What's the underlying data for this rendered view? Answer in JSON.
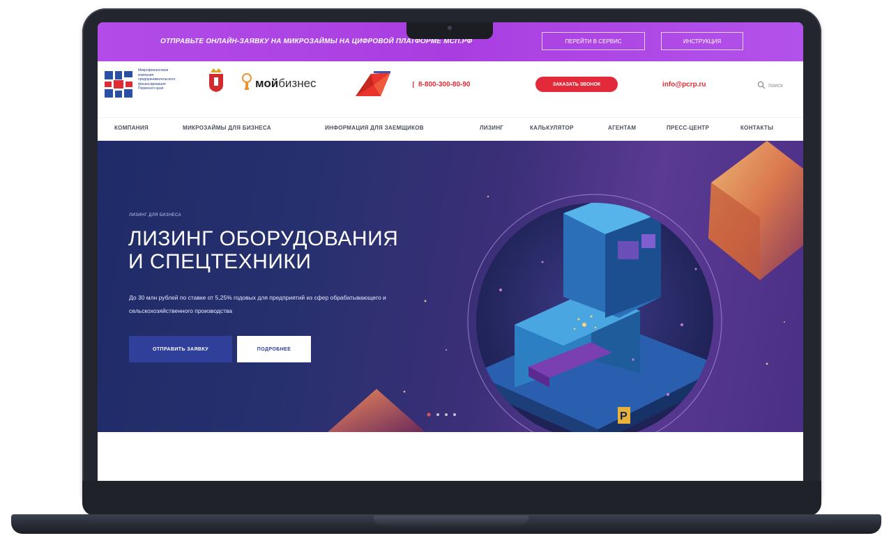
{
  "promo": {
    "text": "ОТПРАВЬТЕ ОНЛАЙН-ЗАЯВКУ НА МИКРОЗАЙМЫ НА ЦИФРОВОЙ ПЛАТФОРМЕ МСП.РФ",
    "go_service": "ПЕРЕЙТИ В СЕРВИС",
    "instruction": "ИНСТРУКЦИЯ"
  },
  "header": {
    "fund_name": "Микрофинансовая компания предпринимательского финансирования Пермского края",
    "moy_prefix": "мой",
    "moy_suffix": "бизнес",
    "phone": "8-800-300-80-90",
    "phone_icon": "phone-icon",
    "callback": "ЗАКАЗАТЬ ЗВОНОК",
    "email": "info@pcrp.ru",
    "search_label": "поиск",
    "search_icon": "search-icon"
  },
  "nav": {
    "items": [
      "КОМПАНИЯ",
      "МИКРОЗАЙМЫ ДЛЯ БИЗНЕСА",
      "ИНФОРМАЦИЯ ДЛЯ ЗАЕМЩИКОВ",
      "ЛИЗИНГ",
      "КАЛЬКУЛЯТОР",
      "АГЕНТАМ",
      "ПРЕСС-ЦЕНТР",
      "КОНТАКТЫ"
    ]
  },
  "hero": {
    "eyebrow": "ЛИЗИНГ ДЛЯ БИЗНЕСА",
    "title_line1": "ЛИЗИНГ ОБОРУДОВАНИЯ",
    "title_line2": "И СПЕЦТЕХНИКИ",
    "description": "До 30 млн рублей по ставке от 5,25% годовых для предприятий из сфер обрабатывающего и сельскохозяйственного производства",
    "submit": "ОТПРАВИТЬ ЗАЯВКУ",
    "more": "ПОДРОБНЕЕ"
  },
  "colors": {
    "promo": "#b24be8",
    "accent_red": "#e22a3a",
    "hero_start": "#1f2b68",
    "hero_end": "#5a3a93",
    "primary_button": "#2f3f9a"
  }
}
